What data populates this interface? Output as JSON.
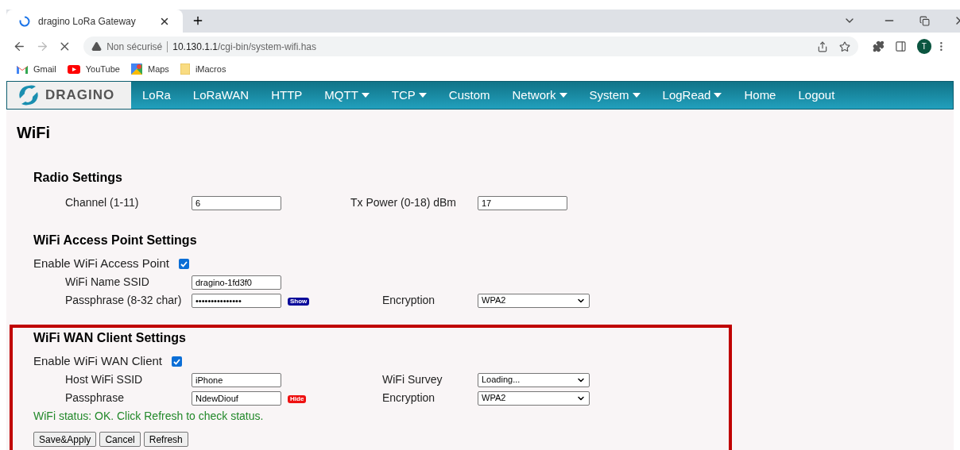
{
  "browser": {
    "tab": {
      "title": "dragino LoRa Gateway",
      "loading": true
    },
    "address": {
      "security": "Non sécurisé",
      "url_host": "10.130.1.1",
      "url_path": "/cgi-bin/system-wifi.has"
    },
    "profile_initial": "T",
    "bookmarks": [
      {
        "label": "Gmail",
        "kind": "gmail"
      },
      {
        "label": "YouTube",
        "kind": "youtube"
      },
      {
        "label": "Maps",
        "kind": "maps"
      },
      {
        "label": "iMacros",
        "kind": "folder"
      }
    ]
  },
  "nav": {
    "logo": "DRAGINO",
    "items": [
      {
        "label": "LoRa",
        "dropdown": false
      },
      {
        "label": "LoRaWAN",
        "dropdown": false
      },
      {
        "label": "HTTP",
        "dropdown": false
      },
      {
        "label": "MQTT",
        "dropdown": true
      },
      {
        "label": "TCP",
        "dropdown": true
      },
      {
        "label": "Custom",
        "dropdown": false
      },
      {
        "label": "Network",
        "dropdown": true
      },
      {
        "label": "System",
        "dropdown": true
      },
      {
        "label": "LogRead",
        "dropdown": true
      },
      {
        "label": "Home",
        "dropdown": false
      },
      {
        "label": "Logout",
        "dropdown": false
      }
    ]
  },
  "page_title": "WiFi",
  "sections": [
    {
      "title": "Radio Settings",
      "highlighted": false,
      "rows": [
        {
          "kind": "wide_fields",
          "fields": [
            {
              "label": "Channel (1-11)",
              "kind": "text",
              "value": "6"
            },
            {
              "label": "Tx Power (0-18) dBm",
              "kind": "text",
              "value": "17"
            }
          ]
        }
      ]
    },
    {
      "title": "WiFi Access Point Settings",
      "highlighted": false,
      "rows": [
        {
          "kind": "checkbox",
          "label": "Enable WiFi Access Point",
          "checked": true
        },
        {
          "kind": "fields",
          "fields": [
            {
              "label": "WiFi Name SSID",
              "kind": "text",
              "value": "dragino-1fd3f0"
            }
          ]
        },
        {
          "kind": "fields",
          "fields": [
            {
              "label": "Passphrase (8-32 char)",
              "kind": "password",
              "value": "•••••••••••••••",
              "toggle": {
                "label": "Show",
                "color": "#0a0a9a"
              }
            },
            {
              "label": "Encryption",
              "kind": "select",
              "value": "WPA2"
            }
          ]
        }
      ]
    },
    {
      "title": "WiFi WAN Client Settings",
      "highlighted": true,
      "rows": [
        {
          "kind": "checkbox",
          "label": "Enable WiFi WAN Client",
          "checked": true
        },
        {
          "kind": "fields",
          "fields": [
            {
              "label": "Host WiFi SSID",
              "kind": "text",
              "value": "iPhone"
            },
            {
              "label": "WiFi Survey",
              "kind": "select",
              "value": "Loading..."
            }
          ]
        },
        {
          "kind": "fields",
          "fields": [
            {
              "label": "Passphrase",
              "kind": "text",
              "value": "NdewDiouf",
              "toggle": {
                "label": "Hide",
                "color": "#ee1111"
              }
            },
            {
              "label": "Encryption",
              "kind": "select",
              "value": "WPA2"
            }
          ]
        },
        {
          "kind": "status",
          "text": "WiFi status: OK. Click Refresh to check status."
        },
        {
          "kind": "buttons",
          "buttons": [
            "Save&Apply",
            "Cancel",
            "Refresh"
          ]
        }
      ]
    }
  ]
}
